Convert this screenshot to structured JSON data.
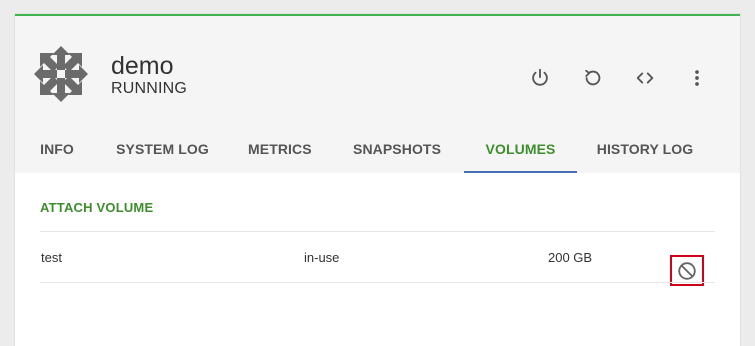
{
  "vm": {
    "name": "demo",
    "status": "RUNNING"
  },
  "actions": {
    "power_icon": "power-icon",
    "restart_icon": "restart-icon",
    "console_icon": "code-icon",
    "more_icon": "more-vertical-icon"
  },
  "tabs": [
    {
      "label": "INFO",
      "active": false
    },
    {
      "label": "SYSTEM LOG",
      "active": false
    },
    {
      "label": "METRICS",
      "active": false
    },
    {
      "label": "SNAPSHOTS",
      "active": false
    },
    {
      "label": "VOLUMES",
      "active": true
    },
    {
      "label": "HISTORY LOG",
      "active": false
    }
  ],
  "volumes": {
    "attach_label": "ATTACH VOLUME",
    "rows": [
      {
        "name": "test",
        "state": "in-use",
        "size": "200 GB",
        "action_icon": "detach-icon"
      }
    ]
  },
  "colors": {
    "accent_green": "#3e8e2f",
    "top_border": "#3fb34f",
    "active_tab_underline": "#4a6fb4",
    "highlight_box": "#d0021b"
  }
}
